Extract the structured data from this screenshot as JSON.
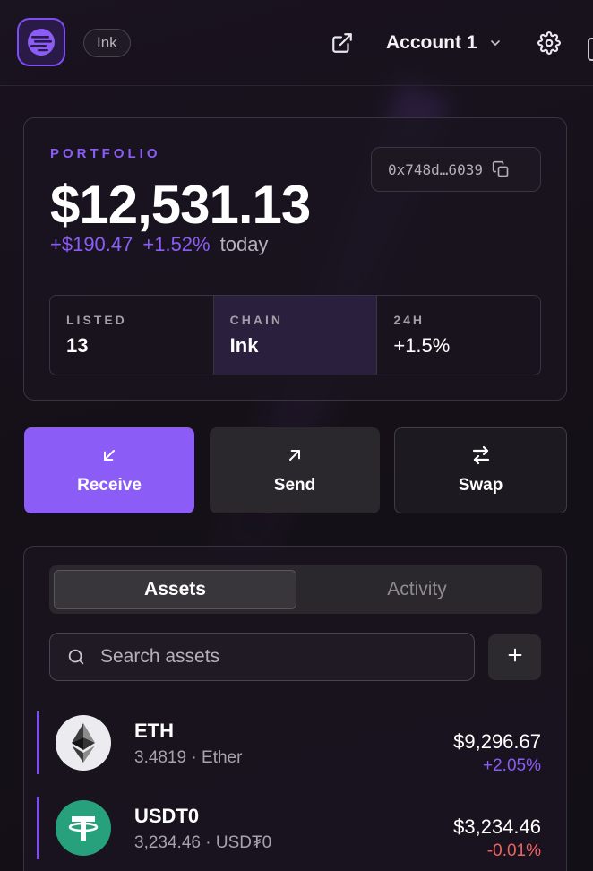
{
  "colors": {
    "accent": "#8b5cf6",
    "negative": "#f06262",
    "background": "#151018",
    "usdt": "#26a17b"
  },
  "header": {
    "logo_icon": "ink-logo-icon",
    "chain_chip": "Ink",
    "external_icon": "external-link-icon",
    "account_label": "Account 1",
    "account_chevron_icon": "chevron-down-icon",
    "settings_icon": "gear-icon"
  },
  "portfolio": {
    "label": "PORTFOLIO",
    "total": "$12,531.13",
    "change_amount": "+$190.47",
    "change_percent": "+1.52%",
    "change_period": "today",
    "address": "0x748d…6039",
    "copy_icon": "copy-icon",
    "stats": [
      {
        "key": "LISTED",
        "value": "13"
      },
      {
        "key": "CHAIN",
        "value": "Ink"
      },
      {
        "key": "24H",
        "value": "+1.5%"
      }
    ]
  },
  "actions": {
    "receive": {
      "label": "Receive",
      "icon": "arrow-down-left-icon"
    },
    "send": {
      "label": "Send",
      "icon": "arrow-up-right-icon"
    },
    "swap": {
      "label": "Swap",
      "icon": "swap-arrows-icon"
    }
  },
  "assets_panel": {
    "tabs": [
      "Assets",
      "Activity"
    ],
    "active_tab": "Assets",
    "search_placeholder": "Search assets",
    "search_icon": "search-icon",
    "add_icon": "plus-icon",
    "assets": [
      {
        "symbol": "ETH",
        "amount": "3.4819",
        "name": "Ether",
        "value": "$9,296.67",
        "change": "+2.05%",
        "direction": "up",
        "icon": "ethereum-icon"
      },
      {
        "symbol": "USDT0",
        "amount": "3,234.46",
        "name": "USD₮0",
        "value": "$3,234.46",
        "change": "-0.01%",
        "direction": "down",
        "icon": "tether-icon"
      }
    ]
  }
}
